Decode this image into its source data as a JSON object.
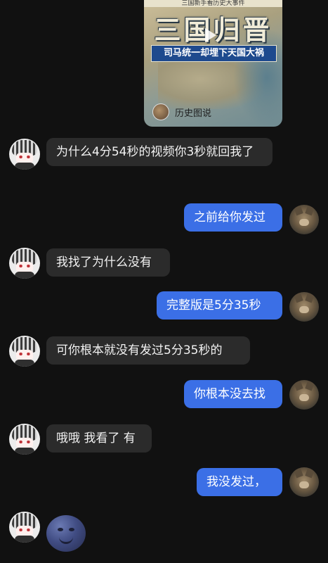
{
  "video_card": {
    "top_text": "三国新手看历史大事件",
    "title": "三国归晋",
    "subtitle": "司马统一却埋下天国大祸",
    "source_name": "历史图说"
  },
  "messages": [
    {
      "side": "left",
      "text": "为什么4分54秒的视频你3秒就回我了"
    },
    {
      "side": "right",
      "text": "之前给你发过"
    },
    {
      "side": "left",
      "text": "我找了为什么没有"
    },
    {
      "side": "right",
      "text": "完整版是5分35秒"
    },
    {
      "side": "left",
      "text": "可你根本就没有发过5分35秒的"
    },
    {
      "side": "right",
      "text": "你根本没去找"
    },
    {
      "side": "left",
      "text": "哦哦 我看了 有"
    },
    {
      "side": "right",
      "text": "我没发过，"
    },
    {
      "side": "left",
      "sticker": "moon-face-emoji"
    }
  ],
  "colors": {
    "background": "#111111",
    "bubble_left": "#2b2b2b",
    "bubble_right": "#3b6fe6"
  }
}
